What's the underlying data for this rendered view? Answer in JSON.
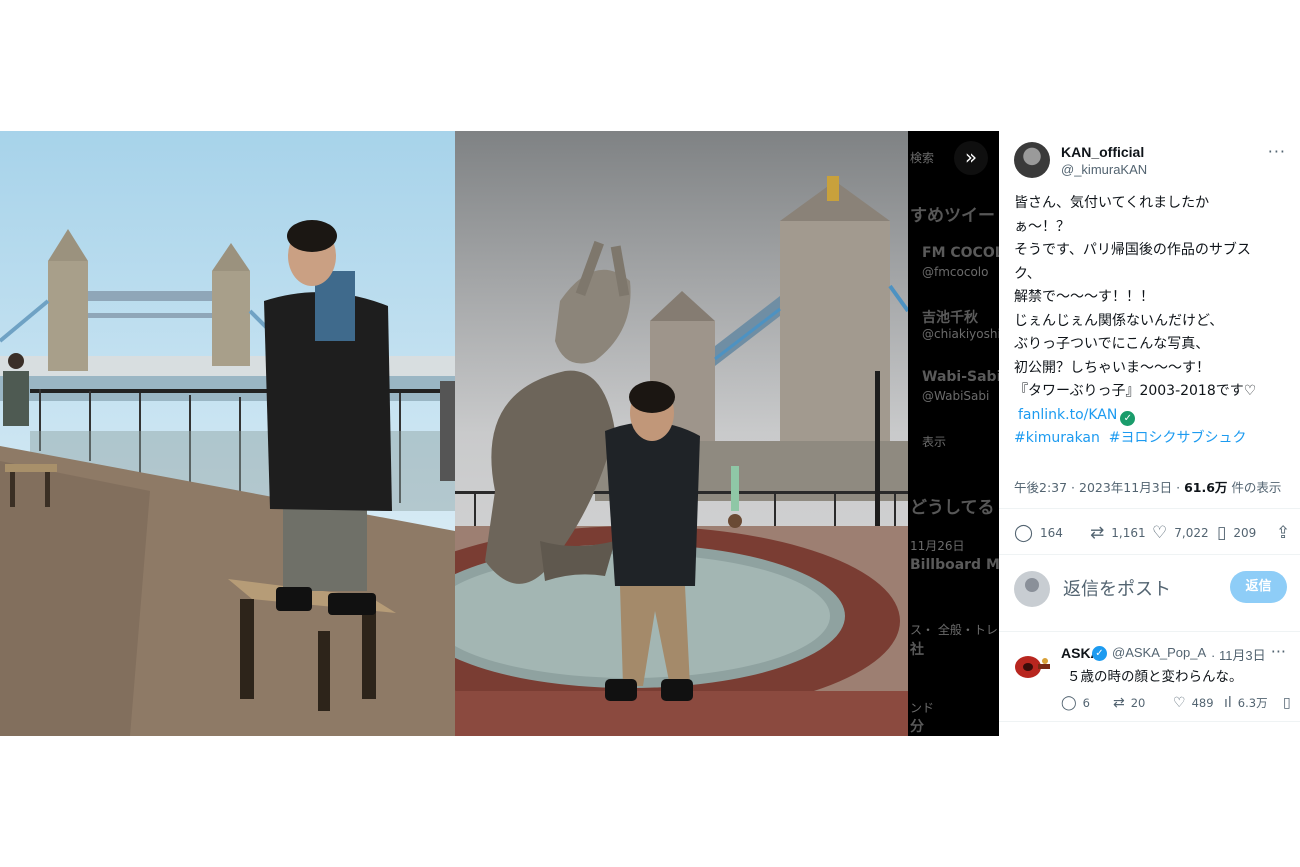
{
  "sidebar_dimmed": {
    "search": "検索",
    "section1": "すめツイー",
    "items": [
      {
        "name": "FM COCOLO",
        "handle": "@fmcocolo"
      },
      {
        "name": "吉池千秋",
        "handle": "@chiakiyoshi"
      },
      {
        "name": "Wabi-Sabi",
        "handle": "@WabiSabi"
      }
    ],
    "more": "表示",
    "section2": "どうしてる",
    "trend_meta": "11月26日",
    "trend_title": "Billboard Mus",
    "trend2_meta": "ス・ 全般・トレン",
    "trend2_title": "社",
    "trend3_meta": "ンド",
    "trend3_title": "分"
  },
  "tweet": {
    "author_name": "KAN_official",
    "author_handle": "@_kimuraKAN",
    "more_label": "···",
    "lines": [
      "皆さん、気付いてくれましたか",
      "ぁ～！？",
      "そうです、パリ帰国後の作品のサブス",
      "ク、",
      "解禁で～～～す！！！",
      "じぇんじぇん関係ないんだけど、",
      "ぶりっ子ついでにこんな写真、",
      "初公開？しちゃいま～～～す！",
      "『タワーぶりっ子』2003-2018です♡"
    ],
    "link": "fanlink.to/KAN",
    "hashtag1": "#kimurakan",
    "hashtag2": "#ヨロシクサブシュク",
    "time": "午後2:37 · 2023年11月3日 · ",
    "views": "61.6万",
    "views_suffix": " 件の表示",
    "replies": "164",
    "reposts": "1,161",
    "likes": "7,022",
    "bookmarks": "209"
  },
  "reply_box": {
    "placeholder": "返信をポスト",
    "button": "返信"
  },
  "comment": {
    "name": "ASKA",
    "handle": "@ASKA_Pop_ASKA",
    "date": "· 11月3日",
    "more_label": "···",
    "text": "５歳の時の顔と変わらんな。",
    "replies": "6",
    "reposts": "20",
    "likes": "489",
    "views": "6.3万"
  },
  "icons": {
    "expand": "double-chevron-right-icon",
    "reply": "speech-bubble-icon",
    "repost": "repost-arrows-icon",
    "like": "heart-icon",
    "bookmark": "bookmark-icon",
    "share": "share-upload-icon",
    "views": "bar-chart-icon",
    "verified": "verified-badge-icon"
  },
  "colors": {
    "link": "#1d9bf0",
    "reply_button": "#8ecdf7",
    "muted": "#536471"
  }
}
